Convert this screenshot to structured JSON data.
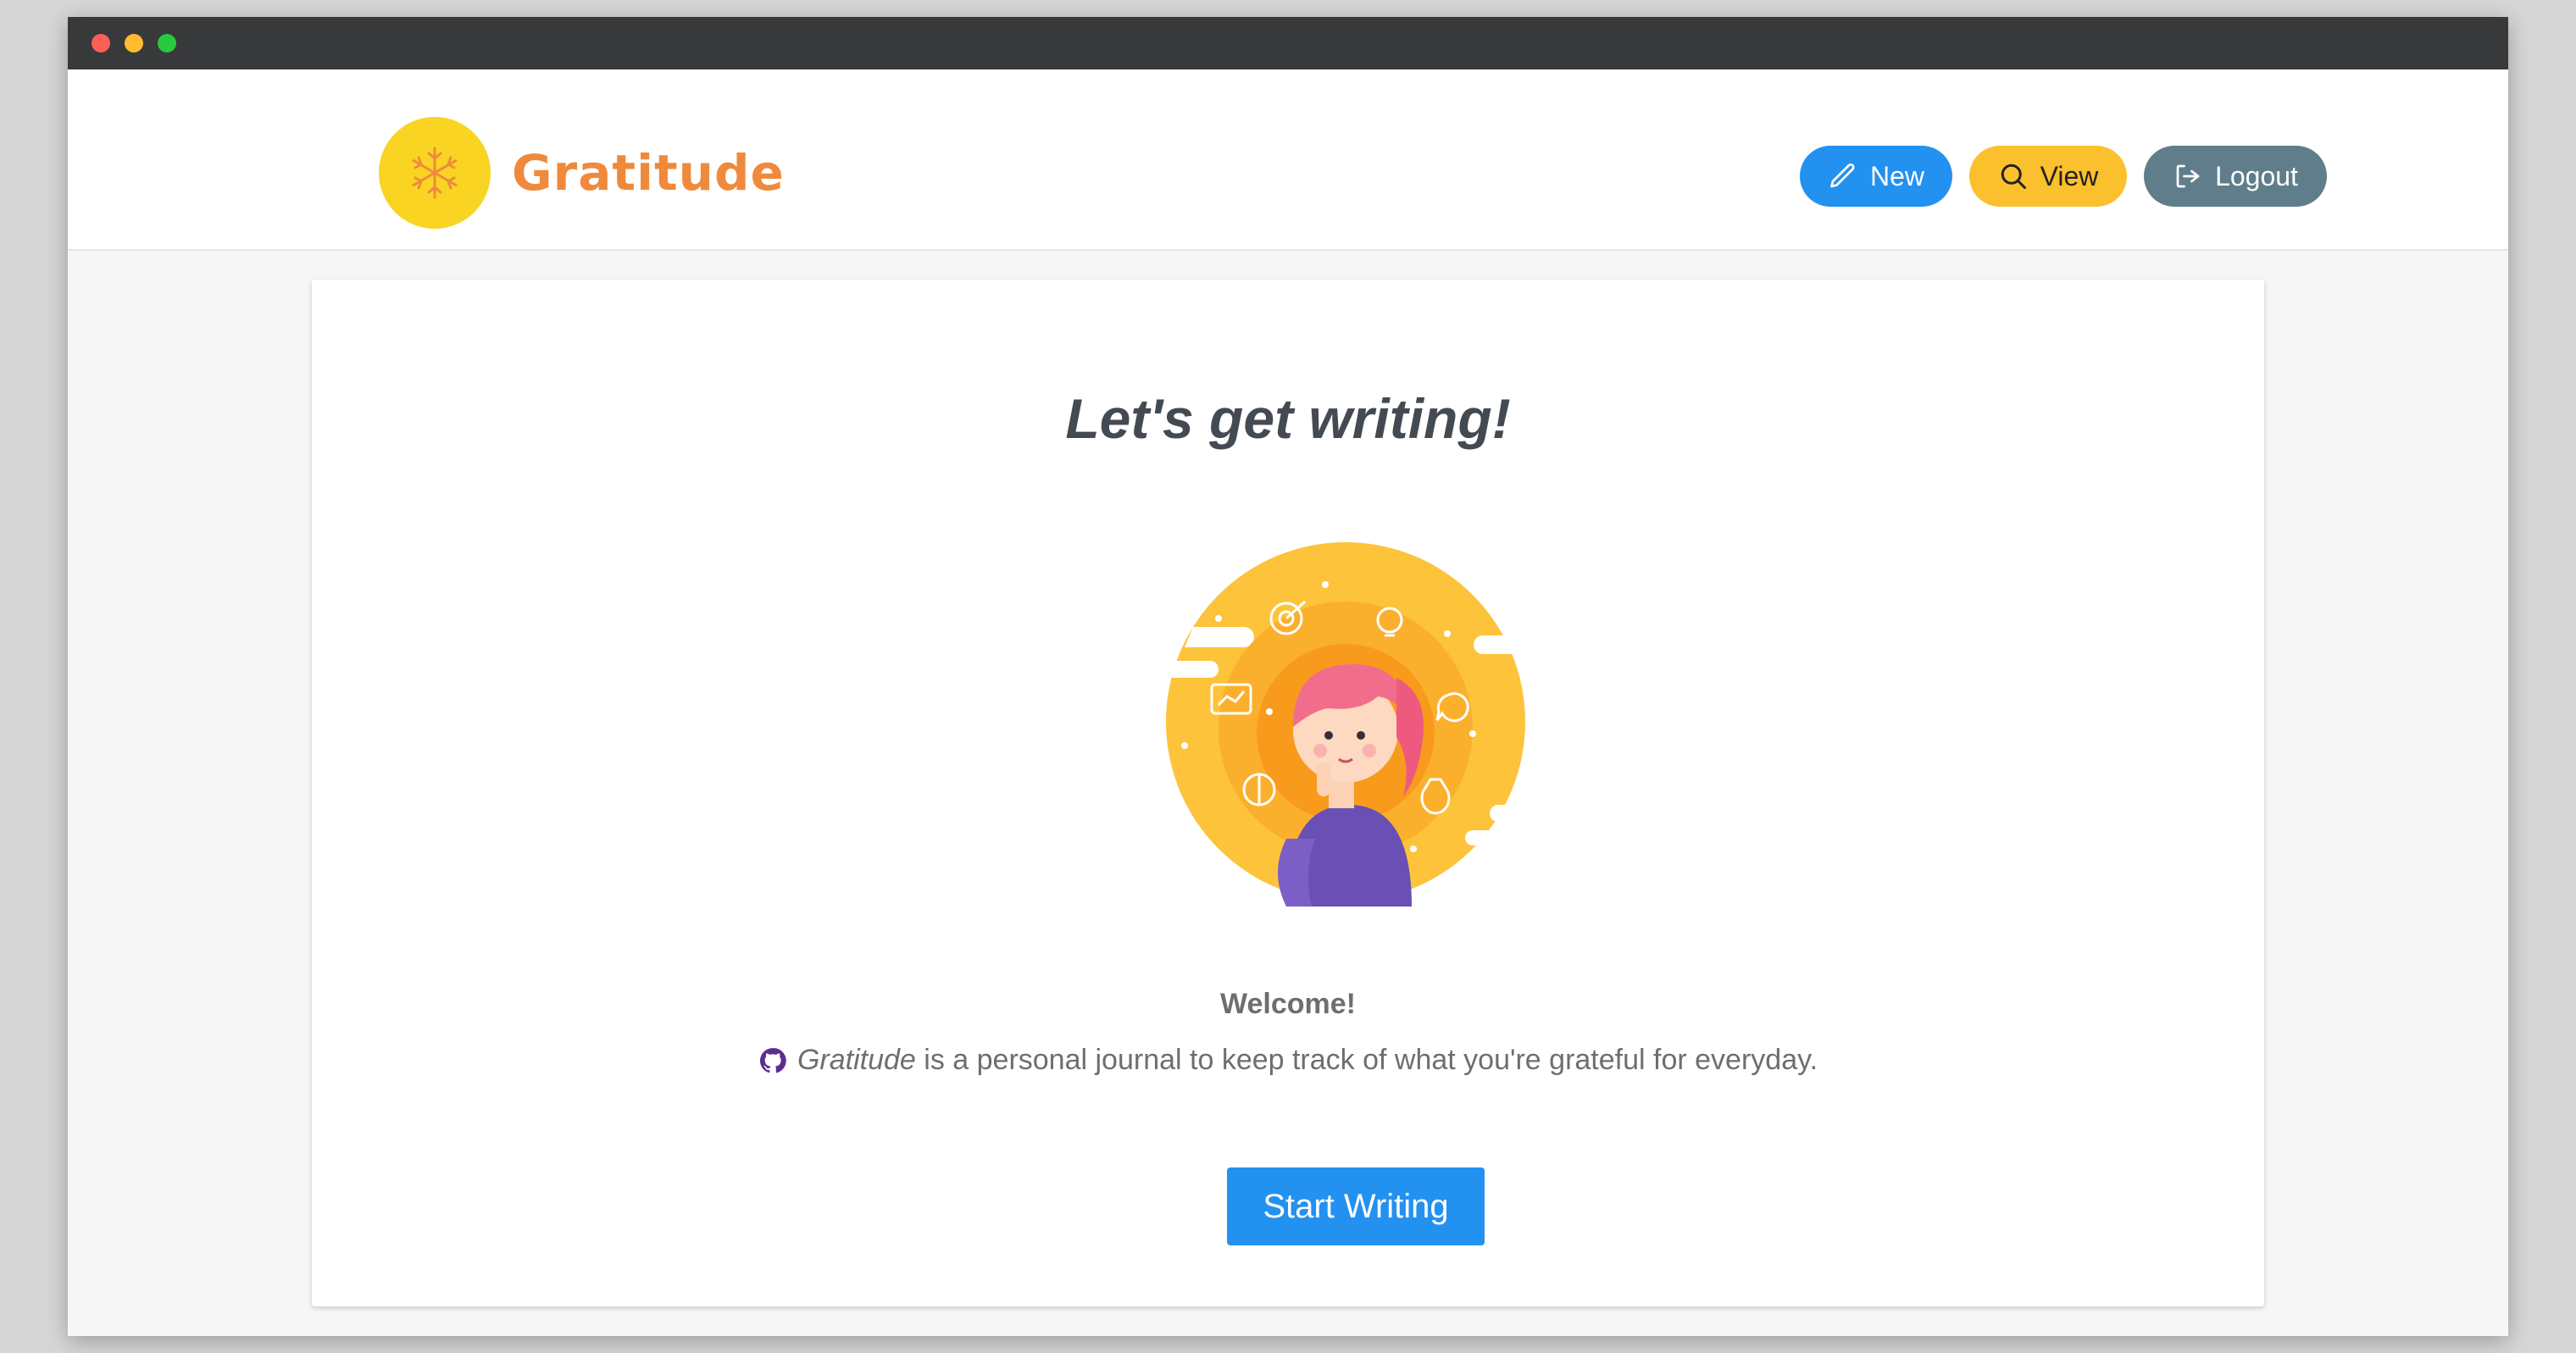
{
  "app": {
    "brand": "Gratitude",
    "logo_icon": "snowflake-icon"
  },
  "nav": {
    "new_label": "New",
    "new_icon": "pencil-icon",
    "view_label": "View",
    "view_icon": "search-icon",
    "logout_label": "Logout",
    "logout_icon": "logout-icon"
  },
  "main": {
    "heading": "Let's get writing!",
    "welcome": "Welcome!",
    "description_app_name": "Gratitude",
    "description_rest": " is a personal journal to keep track of what you're grateful for everyday.",
    "description_icon": "github-icon",
    "start_label": "Start Writing"
  },
  "colors": {
    "primary": "#2391f0",
    "accent_yellow": "#fbc02d",
    "logout_gray": "#607d8b",
    "brand_orange": "#ef8a3c",
    "logo_yellow": "#f9d423"
  }
}
